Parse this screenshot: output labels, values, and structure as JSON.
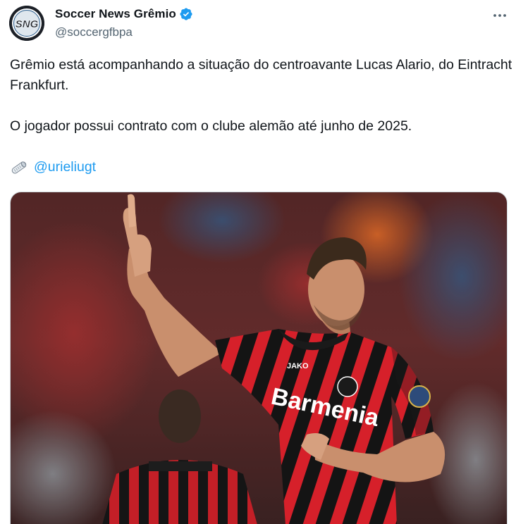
{
  "author": {
    "display_name": "Soccer News Grêmio",
    "handle": "@soccergfbpa",
    "avatar_text": "SNG",
    "verified": true
  },
  "tweet": {
    "paragraph_1": "Grêmio está acompanhando a situação do centroavante Lucas Alario, do Eintracht Frankfurt.",
    "paragraph_2": "O jogador possui contrato com o clube alemão até junho de 2025.",
    "source_icon": "rolled-newspaper-icon",
    "mention": "@urieliugt"
  },
  "media": {
    "jersey_sponsor": "Barmenia",
    "jersey_brand": "JAKO"
  },
  "colors": {
    "accent": "#1d9bf0",
    "text": "#0f1419",
    "secondary": "#536471",
    "jersey_red": "#d6202a",
    "jersey_black": "#141414"
  }
}
